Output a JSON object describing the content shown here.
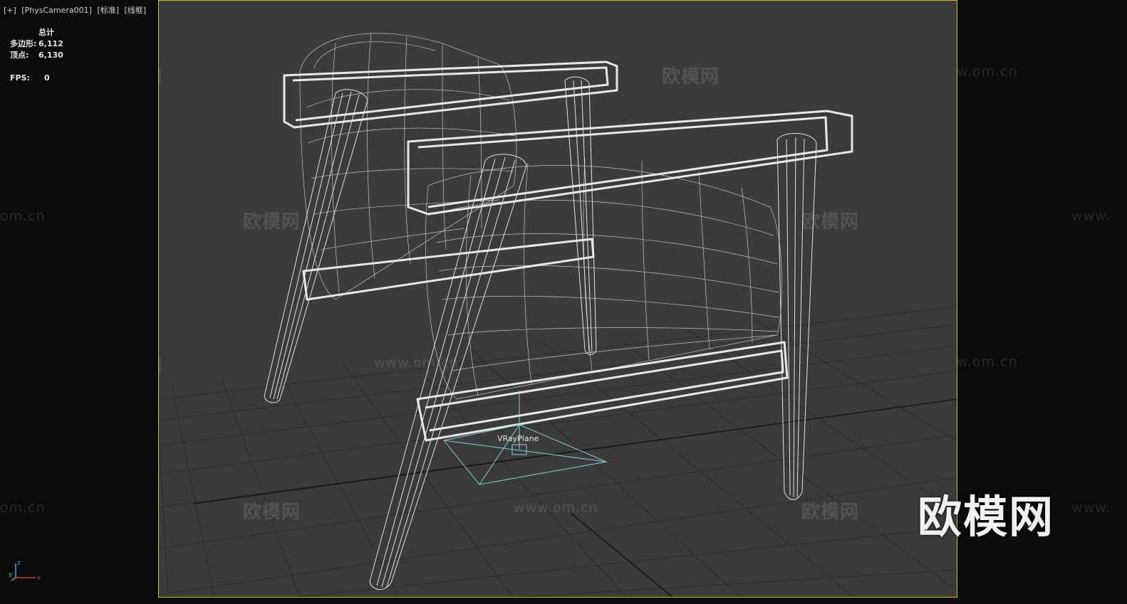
{
  "viewport": {
    "labels": [
      "[+]",
      "[PhysCamera001]",
      "[标准]",
      "[线框]"
    ],
    "stats_header": "总计",
    "polygons_label": "多边形:",
    "polygons_value": "6,112",
    "vertices_label": "顶点:",
    "vertices_value": "6,130",
    "fps_label": "FPS:",
    "fps_value": "0",
    "object_label": "VRayPlane",
    "axes": {
      "x": "x",
      "y": "y",
      "z": "z"
    }
  },
  "watermarks": {
    "cn": "欧模网",
    "url": "www.om.cn",
    "url_partial": "om.cn",
    "url_left": "www."
  },
  "colors": {
    "viewport_bg": "#3b3b3b",
    "frame_border": "#c9c21b",
    "wire": "#e4e4e4",
    "grid": "#2a2a2a",
    "vray_gizmo": "#7fd3d6"
  }
}
